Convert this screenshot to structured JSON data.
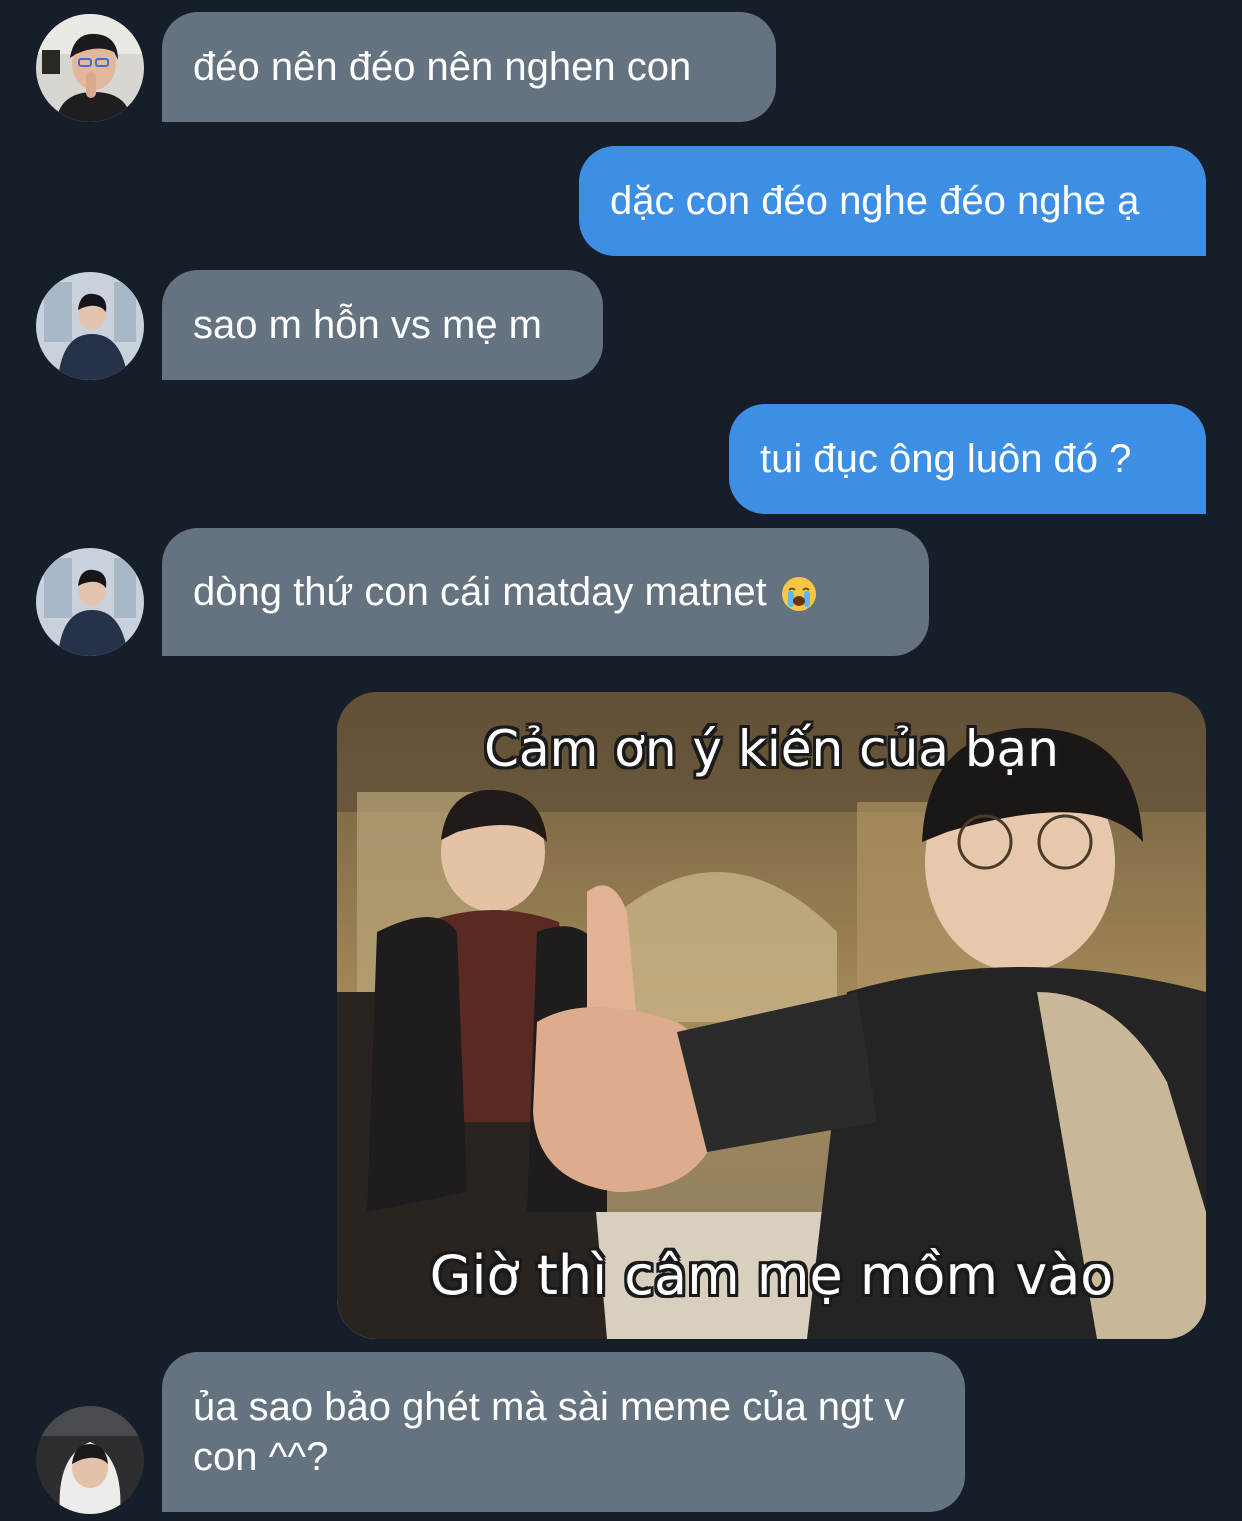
{
  "messages": [
    {
      "text": "đéo nên đéo nên nghen con"
    },
    {
      "text": "dặc con đéo nghe đéo nghe ạ"
    },
    {
      "text": "sao m hỗn vs mẹ m"
    },
    {
      "text": "tui đục ông luôn đó ?"
    },
    {
      "text": "dòng thứ con cái matday matnet",
      "emoji": "loudly-crying-face-emoji"
    },
    {
      "caption_top": "Cảm ơn ý kiến của bạn",
      "caption_bottom": "Giờ thì câm mẹ mồm vào"
    },
    {
      "text": "ủa sao bảo ghét mà sài meme của ngt v con ^^?"
    }
  ],
  "colors": {
    "background": "#161e29",
    "incoming_bubble": "#65727f",
    "outgoing_bubble": "#3d8fe6",
    "text": "#ffffff"
  }
}
